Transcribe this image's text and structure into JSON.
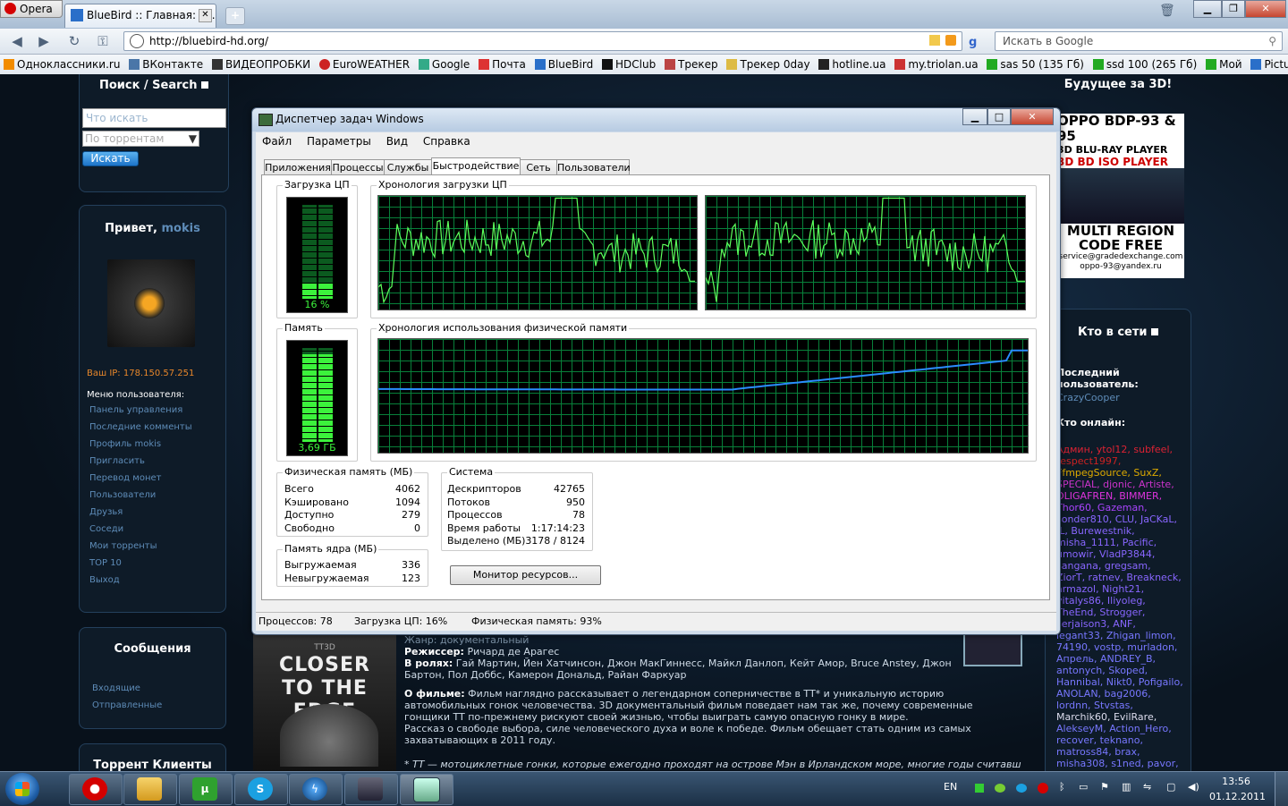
{
  "browser": {
    "opera_label": "Opera",
    "tab_title": "BlueBird :: Главная: ск...",
    "url": "http://bluebird-hd.org/",
    "search_placeholder": "Искать в Google",
    "bookmarks": [
      "Одноклассники.ru",
      "ВКонтакте",
      "ВИДЕОПРОБКИ",
      "EuroWEATHER",
      "Google",
      "Почта",
      "BlueBird",
      "HDClub",
      "Трекер",
      "Трекер 0day",
      "hotline.ua",
      "my.triolan.ua",
      "sas 50 (135 Гб)",
      "ssd 100 (265 Гб)",
      "Мой",
      "PictureShack"
    ]
  },
  "left": {
    "search_title": "Поиск / Search",
    "search_value": "Что искать",
    "search_select": "По торрентам",
    "search_button": "Искать",
    "greeting": "Привет,",
    "username": "mokis",
    "ip": "Ваш IP: 178.150.57.251",
    "menu_title": "Меню пользователя:",
    "menu": [
      "Панель управления",
      "Последние комменты",
      "Профиль mokis",
      "Пригласить",
      "Перевод монет",
      "Пользователи",
      "Друзья",
      "Соседи",
      "Мои торренты",
      "TOP 10",
      "Выход"
    ],
    "messages_title": "Сообщения",
    "messages": [
      "Входящие",
      "Отправленные"
    ],
    "clients_title": "Торрент Клиенты"
  },
  "right": {
    "ad_title": "Будущее за 3D!",
    "ad_lines": [
      "OPPO BDP-93 & 95",
      "3D BLU-RAY PLAYER",
      "3D BD ISO PLAYER",
      "MULTI REGION",
      "CODE FREE",
      "service@gradedexchange.com",
      "oppo-93@yandex.ru"
    ],
    "online_title": "Кто в сети",
    "last_user_label": "Последний пользователь:",
    "last_user": "CrazyCooper",
    "who_online": "Кто онлайн:",
    "online_lines": [
      {
        "t": "Админ, ytol12, subfeel,",
        "c": "#d23"
      },
      {
        "t": "respect1997,",
        "c": "#c22"
      },
      {
        "t": "FfmpegSource, SuxZ,",
        "c": "#da0"
      },
      {
        "t": "SPECIAL, djonic, Artiste,",
        "c": "#c3c"
      },
      {
        "t": "OLIGAFREN, BIMMER,",
        "c": "#d3d"
      },
      {
        "t": "Thor60, Gazeman,",
        "c": "#a4f"
      },
      {
        "t": "sonder810, CLU, JaCKaL,",
        "c": "#86f"
      },
      {
        "t": "JL, Burewestnik,",
        "c": "#86f"
      },
      {
        "t": "misha_1111, Pacific,",
        "c": "#86f"
      },
      {
        "t": "umowir, VladP3844,",
        "c": "#86f"
      },
      {
        "t": "sangana, gregsam,",
        "c": "#86f"
      },
      {
        "t": "ZiorT, ratnev, Breakneck,",
        "c": "#86f"
      },
      {
        "t": "armazol, Night21,",
        "c": "#86f"
      },
      {
        "t": "vitalys86, Iliyoleg,",
        "c": "#86f"
      },
      {
        "t": "TheEnd, Strogger,",
        "c": "#86f"
      },
      {
        "t": "serjaison3, ANF,",
        "c": "#86f"
      },
      {
        "t": "legant33, Zhigan_limon,",
        "c": "#77f"
      },
      {
        "t": "74190, vostp, murladon,",
        "c": "#77f"
      },
      {
        "t": "Апрель, ANDREY_B,",
        "c": "#77f"
      },
      {
        "t": "antonych, Skoped,",
        "c": "#77f"
      },
      {
        "t": "Hannibal, Nikt0, Pofigailo,",
        "c": "#77f"
      },
      {
        "t": "ANOLAN, bag2006,",
        "c": "#77f"
      },
      {
        "t": "lordnn, Stvstas,",
        "c": "#77f"
      },
      {
        "t": "Marchik60, EvilRare,",
        "c": "#dde"
      },
      {
        "t": "AlekseyM, Action_Hero,",
        "c": "#77f"
      },
      {
        "t": "recover, teknano,",
        "c": "#77f"
      },
      {
        "t": "matross84, brax,",
        "c": "#77f"
      },
      {
        "t": "misha308, s1ned, pavor,",
        "c": "#77f"
      }
    ]
  },
  "movie": {
    "poster_tag": "TT3D",
    "poster_title": "CLOSER TO THE EDGE",
    "genre_cut": "Жанр: документальный",
    "director_label": "Режиссер:",
    "director": "Ричард де Арагес",
    "cast_label": "В ролях:",
    "cast": "Гай Мартин, Йен Хатчинсон, Джон МакГиннесс, Майкл Данлоп, Кейт Амор, Bruce Anstey, Джон Бартон, Пол Доббс, Камерон Дональд, Райан Фаркуар",
    "about_label": "О фильме:",
    "about": "Фильм наглядно рассказывает о легендарном соперничестве в TT* и уникальную историю автомобильных гонок человечества. 3D документальный фильм поведает нам так же, почему современные гонщики TT по-прежнему рискуют своей жизнью, чтобы выиграть самую опасную гонку в мире.",
    "about2": "Рассказ о свободе выбора, силе человеческого духа и воле к победе. Фильм обещает стать одним из самых захватывающих в 2011 году.",
    "footnote": "* TT — мотоциклетные гонки, которые ежегодно проходят на острове Мэн в Ирландском море, многие годы считавшиеся самыми"
  },
  "taskmanager": {
    "title": "Диспетчер задач Windows",
    "menu": [
      "Файл",
      "Параметры",
      "Вид",
      "Справка"
    ],
    "tabs": [
      "Приложения",
      "Процессы",
      "Службы",
      "Быстродействие",
      "Сеть",
      "Пользователи"
    ],
    "active_tab": "Быстродействие",
    "cpu_label": "Загрузка ЦП",
    "cpu_history_label": "Хронология загрузки ЦП",
    "cpu_value": "16 %",
    "cpu_fraction": 0.16,
    "mem_label": "Память",
    "mem_history_label": "Хронология использования физической памяти",
    "mem_value": "3,69 ГБ",
    "mem_fraction": 0.93,
    "physical_title": "Физическая память (МБ)",
    "physical": [
      [
        "Всего",
        "4062"
      ],
      [
        "Кэшировано",
        "1094"
      ],
      [
        "Доступно",
        "279"
      ],
      [
        "Свободно",
        "0"
      ]
    ],
    "kernel_title": "Память ядра (МБ)",
    "kernel": [
      [
        "Выгружаемая",
        "336"
      ],
      [
        "Невыгружаемая",
        "123"
      ]
    ],
    "system_title": "Система",
    "system": [
      [
        "Дескрипторов",
        "42765"
      ],
      [
        "Потоков",
        "950"
      ],
      [
        "Процессов",
        "78"
      ],
      [
        "Время работы",
        "1:17:14:23"
      ],
      [
        "Выделено (МБ)",
        "3178 / 8124"
      ]
    ],
    "resource_monitor": "Монитор ресурсов...",
    "status_processes": "Процессов: 78",
    "status_cpu": "Загрузка ЦП: 16%",
    "status_mem": "Физическая память: 93%"
  },
  "taskbar": {
    "lang": "EN",
    "time": "13:56",
    "date": "01.12.2011"
  }
}
